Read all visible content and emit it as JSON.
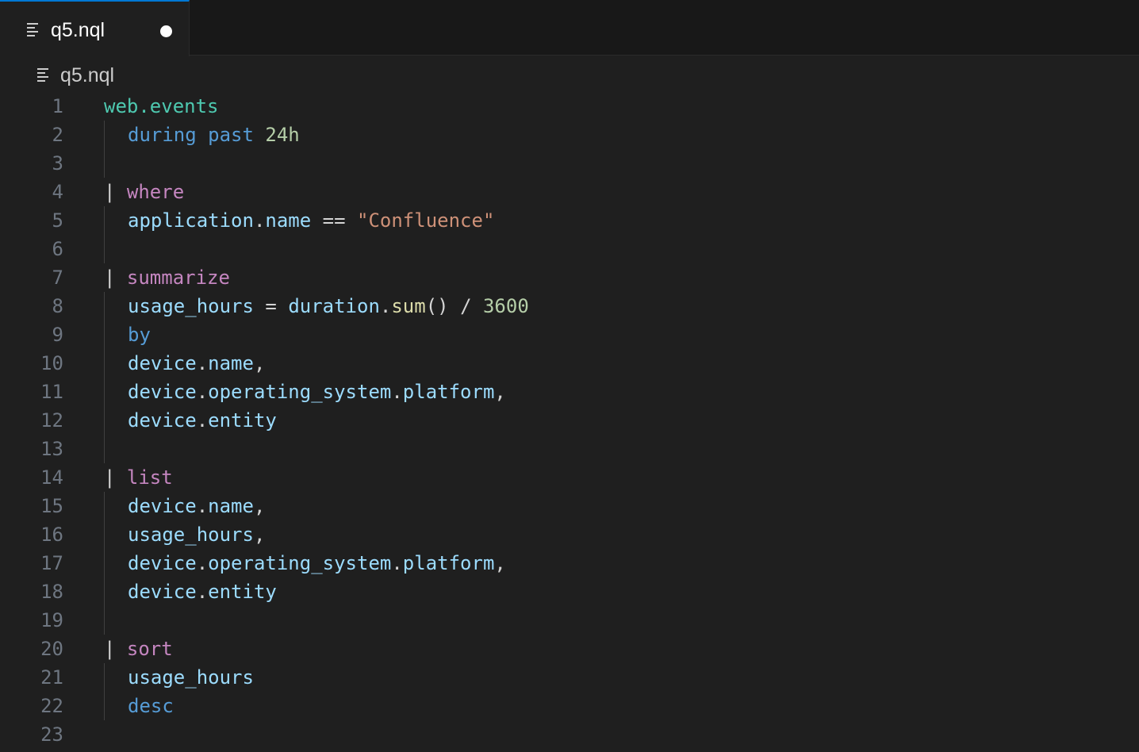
{
  "tab": {
    "label": "q5.nql",
    "icon": "file-text-icon",
    "dirty": true
  },
  "breadcrumb": {
    "label": "q5.nql",
    "icon": "file-text-icon"
  },
  "colors": {
    "tab_active_border": "#0078d4",
    "table": "#4ec9b0",
    "keyword": "#569cd6",
    "number": "#b5cea8",
    "operator": "#c586c0",
    "field": "#9cdcfe",
    "string": "#ce9178",
    "function": "#dcdcaa"
  },
  "lines": [
    {
      "n": "1",
      "pipe": "",
      "tokens": [
        {
          "t": "web.events",
          "c": "t-table"
        }
      ]
    },
    {
      "n": "2",
      "pipe": "",
      "tokens": [
        {
          "t": "during",
          "c": "t-kw"
        },
        {
          "t": " ",
          "c": "t-punct"
        },
        {
          "t": "past",
          "c": "t-kw"
        },
        {
          "t": " ",
          "c": "t-punct"
        },
        {
          "t": "24h",
          "c": "t-num"
        }
      ]
    },
    {
      "n": "3",
      "pipe": "",
      "tokens": []
    },
    {
      "n": "4",
      "pipe": "|",
      "tokens": [
        {
          "t": "where",
          "c": "t-op"
        }
      ]
    },
    {
      "n": "5",
      "pipe": "",
      "tokens": [
        {
          "t": "application",
          "c": "t-field"
        },
        {
          "t": ".",
          "c": "t-punct"
        },
        {
          "t": "name",
          "c": "t-field"
        },
        {
          "t": " == ",
          "c": "t-punct"
        },
        {
          "t": "\"Confluence\"",
          "c": "t-str"
        }
      ]
    },
    {
      "n": "6",
      "pipe": "",
      "tokens": []
    },
    {
      "n": "7",
      "pipe": "|",
      "tokens": [
        {
          "t": "summarize",
          "c": "t-op"
        }
      ]
    },
    {
      "n": "8",
      "pipe": "",
      "tokens": [
        {
          "t": "usage_hours",
          "c": "t-field"
        },
        {
          "t": " = ",
          "c": "t-punct"
        },
        {
          "t": "duration",
          "c": "t-field"
        },
        {
          "t": ".",
          "c": "t-punct"
        },
        {
          "t": "sum",
          "c": "t-fn"
        },
        {
          "t": "() / ",
          "c": "t-punct"
        },
        {
          "t": "3600",
          "c": "t-num"
        }
      ]
    },
    {
      "n": "9",
      "pipe": "",
      "tokens": [
        {
          "t": "by",
          "c": "t-kw"
        }
      ]
    },
    {
      "n": "10",
      "pipe": "",
      "tokens": [
        {
          "t": "device",
          "c": "t-field"
        },
        {
          "t": ".",
          "c": "t-punct"
        },
        {
          "t": "name",
          "c": "t-field"
        },
        {
          "t": ",",
          "c": "t-punct"
        }
      ]
    },
    {
      "n": "11",
      "pipe": "",
      "tokens": [
        {
          "t": "device",
          "c": "t-field"
        },
        {
          "t": ".",
          "c": "t-punct"
        },
        {
          "t": "operating_system",
          "c": "t-field"
        },
        {
          "t": ".",
          "c": "t-punct"
        },
        {
          "t": "platform",
          "c": "t-field"
        },
        {
          "t": ",",
          "c": "t-punct"
        }
      ]
    },
    {
      "n": "12",
      "pipe": "",
      "tokens": [
        {
          "t": "device",
          "c": "t-field"
        },
        {
          "t": ".",
          "c": "t-punct"
        },
        {
          "t": "entity",
          "c": "t-field"
        }
      ]
    },
    {
      "n": "13",
      "pipe": "",
      "tokens": []
    },
    {
      "n": "14",
      "pipe": "|",
      "tokens": [
        {
          "t": "list",
          "c": "t-op"
        }
      ]
    },
    {
      "n": "15",
      "pipe": "",
      "tokens": [
        {
          "t": "device",
          "c": "t-field"
        },
        {
          "t": ".",
          "c": "t-punct"
        },
        {
          "t": "name",
          "c": "t-field"
        },
        {
          "t": ",",
          "c": "t-punct"
        }
      ]
    },
    {
      "n": "16",
      "pipe": "",
      "tokens": [
        {
          "t": "usage_hours",
          "c": "t-field"
        },
        {
          "t": ",",
          "c": "t-punct"
        }
      ]
    },
    {
      "n": "17",
      "pipe": "",
      "tokens": [
        {
          "t": "device",
          "c": "t-field"
        },
        {
          "t": ".",
          "c": "t-punct"
        },
        {
          "t": "operating_system",
          "c": "t-field"
        },
        {
          "t": ".",
          "c": "t-punct"
        },
        {
          "t": "platform",
          "c": "t-field"
        },
        {
          "t": ",",
          "c": "t-punct"
        }
      ]
    },
    {
      "n": "18",
      "pipe": "",
      "tokens": [
        {
          "t": "device",
          "c": "t-field"
        },
        {
          "t": ".",
          "c": "t-punct"
        },
        {
          "t": "entity",
          "c": "t-field"
        }
      ]
    },
    {
      "n": "19",
      "pipe": "",
      "tokens": []
    },
    {
      "n": "20",
      "pipe": "|",
      "tokens": [
        {
          "t": "sort",
          "c": "t-op"
        }
      ]
    },
    {
      "n": "21",
      "pipe": "",
      "tokens": [
        {
          "t": "usage_hours",
          "c": "t-field"
        }
      ]
    },
    {
      "n": "22",
      "pipe": "",
      "tokens": [
        {
          "t": "desc",
          "c": "t-kw"
        }
      ]
    },
    {
      "n": "23",
      "pipe": "",
      "tokens": []
    }
  ]
}
